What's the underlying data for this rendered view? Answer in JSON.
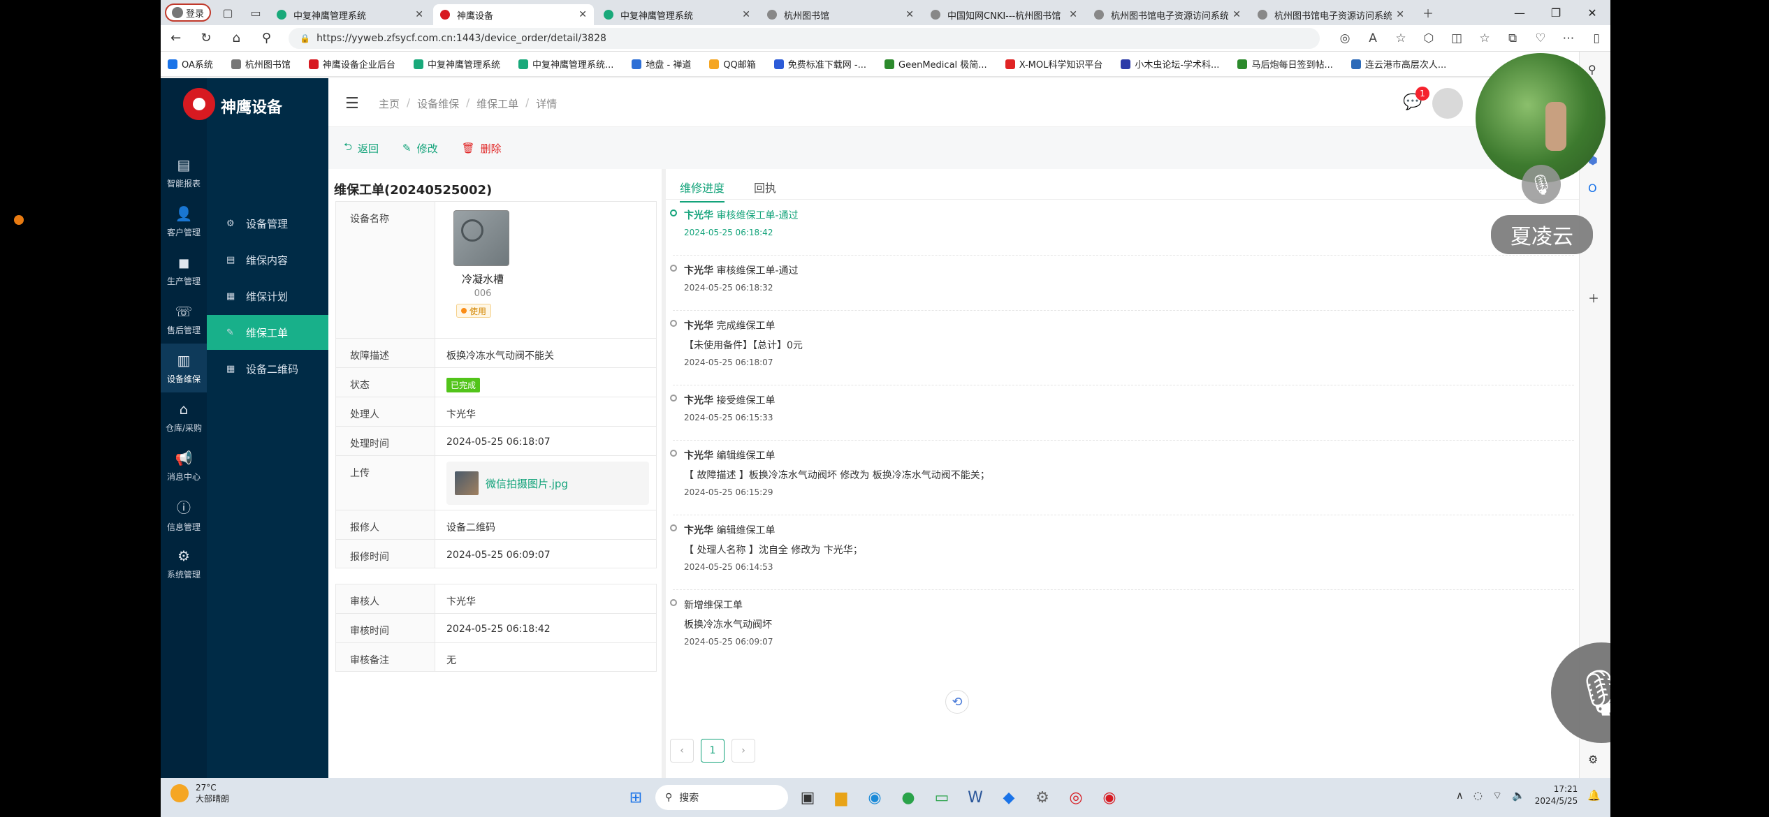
{
  "browser": {
    "profile_label": "登录",
    "tabs": [
      {
        "title": "中复神鹰管理系统",
        "color": "#19a97a",
        "active": false
      },
      {
        "title": "神鹰设备",
        "color": "#d71a21",
        "active": true
      },
      {
        "title": "中复神鹰管理系统",
        "color": "#19a97a",
        "active": false
      },
      {
        "title": "杭州图书馆",
        "color": "#888888",
        "active": false
      },
      {
        "title": "中国知网CNKI---杭州图书馆",
        "color": "#888888",
        "active": false
      },
      {
        "title": "杭州图书馆电子资源访问系统",
        "color": "#888888",
        "active": false
      },
      {
        "title": "杭州图书馆电子资源访问系统",
        "color": "#888888",
        "active": false
      }
    ],
    "url": "https://yyweb.zfsycf.com.cn:1443/device_order/detail/3828",
    "bookmarks": [
      {
        "label": "OA系统",
        "color": "#1a73e8"
      },
      {
        "label": "杭州图书馆",
        "color": "#777777"
      },
      {
        "label": "神鹰设备企业后台",
        "color": "#d71a21"
      },
      {
        "label": "中复神鹰管理系统",
        "color": "#19a97a"
      },
      {
        "label": "中复神鹰管理系统...",
        "color": "#19a97a"
      },
      {
        "label": "地盘 - 禅道",
        "color": "#2d6fd6"
      },
      {
        "label": "QQ邮箱",
        "color": "#f5a623"
      },
      {
        "label": "免费标准下载网 -...",
        "color": "#2c5bd8"
      },
      {
        "label": "GeenMedical 极简...",
        "color": "#2c8a2c"
      },
      {
        "label": "X-MOL科学知识平台",
        "color": "#e02424"
      },
      {
        "label": "小木虫论坛-学术科...",
        "color": "#2c3aa8"
      },
      {
        "label": "马后炮每日签到帖...",
        "color": "#2c8a2c"
      },
      {
        "label": "连云港市高层次人...",
        "color": "#2c6ab8"
      }
    ]
  },
  "app": {
    "brand": "神鹰设备",
    "rail": [
      {
        "label": "智能报表",
        "icon": "report-icon"
      },
      {
        "label": "客户管理",
        "icon": "user-icon"
      },
      {
        "label": "生产管理",
        "icon": "box-icon"
      },
      {
        "label": "售后管理",
        "icon": "support-icon"
      },
      {
        "label": "设备维保",
        "icon": "chart-icon",
        "active": true
      },
      {
        "label": "仓库/采购",
        "icon": "warehouse-icon"
      },
      {
        "label": "消息中心",
        "icon": "megaphone-icon"
      },
      {
        "label": "信息管理",
        "icon": "info-icon"
      },
      {
        "label": "系统管理",
        "icon": "gear-icon"
      }
    ],
    "submenu": [
      {
        "label": "设备管理"
      },
      {
        "label": "维保内容"
      },
      {
        "label": "维保计划"
      },
      {
        "label": "维保工单",
        "active": true
      },
      {
        "label": "设备二维码"
      }
    ],
    "breadcrumb": [
      "主页",
      "设备维保",
      "维保工单",
      "详情"
    ],
    "notification_count": "1",
    "actions": {
      "back": "返回",
      "edit": "修改",
      "delete": "删除"
    }
  },
  "order": {
    "title": "维保工单(20240525002)",
    "device_label": "设备名称",
    "device_name": "冷凝水槽",
    "device_code": "006",
    "device_status": "使用",
    "fields": [
      {
        "key": "故障描述",
        "value": "板换冷冻水气动阀不能关"
      },
      {
        "key": "状态",
        "value": "已完成"
      },
      {
        "key": "处理人",
        "value": "卞光华"
      },
      {
        "key": "处理时间",
        "value": "2024-05-25 06:18:07"
      },
      {
        "key": "上传",
        "value": "微信拍摄图片.jpg"
      },
      {
        "key": "报修人",
        "value": "设备二维码"
      },
      {
        "key": "报修时间",
        "value": "2024-05-25 06:09:07"
      }
    ],
    "review": [
      {
        "key": "审核人",
        "value": "卞光华"
      },
      {
        "key": "审核时间",
        "value": "2024-05-25 06:18:42"
      },
      {
        "key": "审核备注",
        "value": "无"
      }
    ]
  },
  "progress": {
    "tabs": [
      "维修进度",
      "回执"
    ],
    "items": [
      {
        "user": "卞光华",
        "action": "审核维保工单-通过",
        "detail": "",
        "time": "2024-05-25 06:18:42",
        "highlight": true
      },
      {
        "user": "卞光华",
        "action": "审核维保工单-通过",
        "detail": "",
        "time": "2024-05-25 06:18:32",
        "highlight": false
      },
      {
        "user": "卞光华",
        "action": "完成维保工单",
        "detail": "【未使用备件】【总计】0元",
        "time": "2024-05-25 06:18:07",
        "highlight": false
      },
      {
        "user": "卞光华",
        "action": "接受维保工单",
        "detail": "",
        "time": "2024-05-25 06:15:33",
        "highlight": false
      },
      {
        "user": "卞光华",
        "action": "编辑维保工单",
        "detail": "【 故障描述 】板换冷冻水气动阀坏 修改为 板换冷冻水气动阀不能关；",
        "time": "2024-05-25 06:15:29",
        "highlight": false
      },
      {
        "user": "卞光华",
        "action": "编辑维保工单",
        "detail": "【 处理人名称 】沈自全 修改为 卞光华；",
        "time": "2024-05-25 06:14:53",
        "highlight": false
      },
      {
        "user": "",
        "action": "新增维保工单",
        "detail": "板换冷冻水气动阀坏",
        "time": "2024-05-25 06:09:07",
        "highlight": false
      }
    ],
    "page": "1"
  },
  "overlay": {
    "participant_name": "夏凌云"
  },
  "taskbar": {
    "temp": "27°C",
    "weather": "大部晴朗",
    "search_placeholder": "搜索",
    "time": "17:21",
    "date": "2024/5/25"
  }
}
